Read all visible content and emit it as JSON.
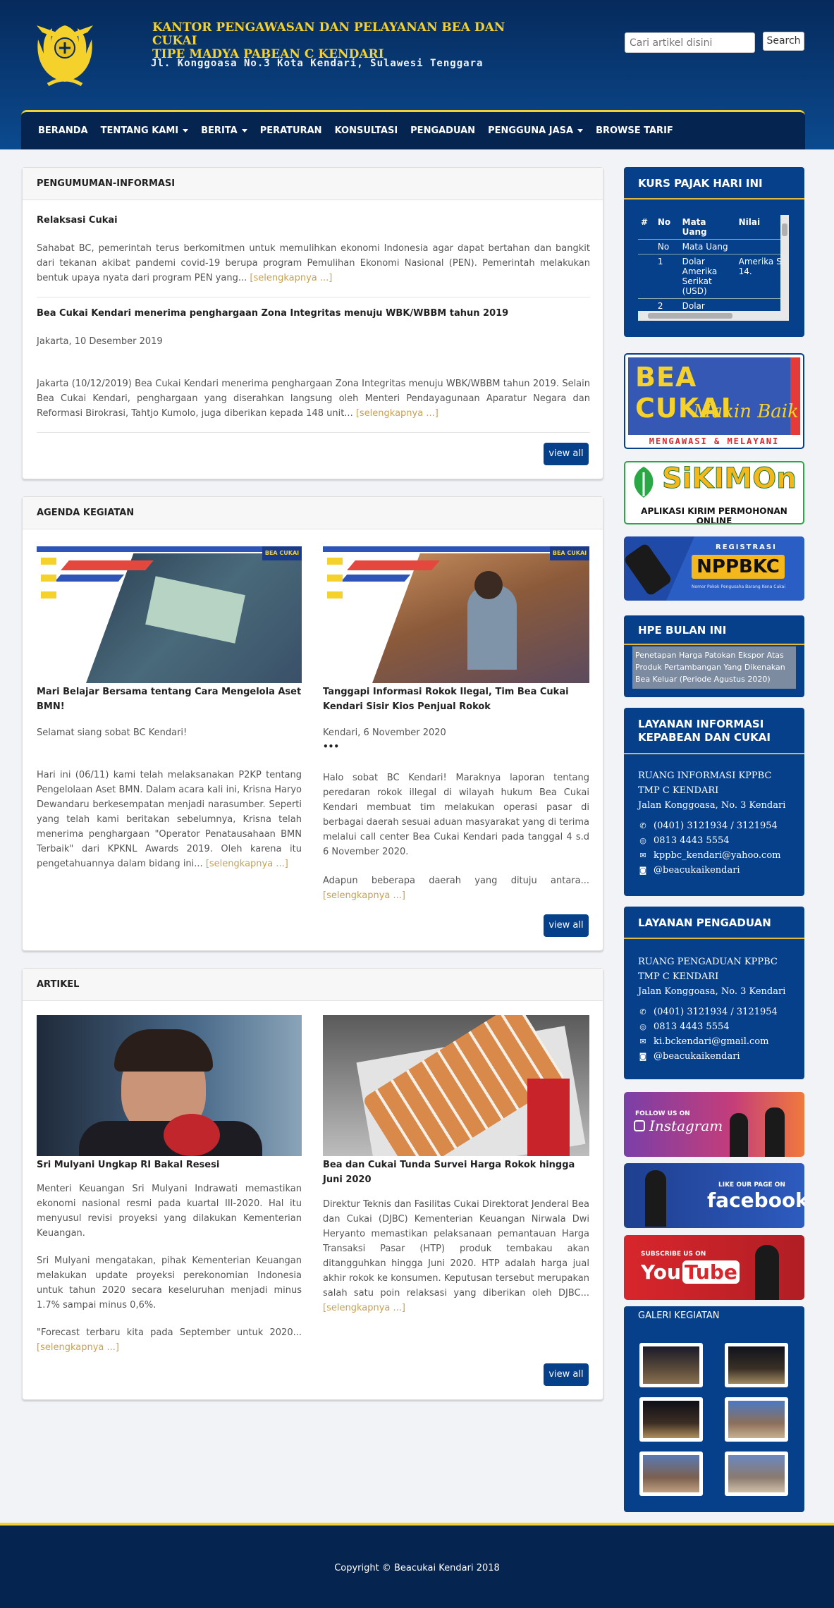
{
  "header": {
    "title_line1": "KANTOR PENGAWASAN DAN PELAYANAN BEA DAN CUKAI",
    "title_line2": "TIPE MADYA PABEAN C KENDARI",
    "address": "Jl. Konggoasa No.3 Kota Kendari, Sulawesi Tenggara",
    "search_placeholder": "Cari artikel disini",
    "search_button": "Search"
  },
  "nav": {
    "items": [
      "BERANDA",
      "TENTANG KAMI",
      "BERITA",
      "PERATURAN",
      "KONSULTASI",
      "PENGADUAN",
      "PENGGUNA JASA",
      "BROWSE TARIF"
    ]
  },
  "pengumuman": {
    "title": "PENGUMUMAN-INFORMASI",
    "items": [
      {
        "title": "Relaksasi Cukai",
        "date": "",
        "text": "Sahabat BC, pemerintah terus berkomitmen untuk memulihkan ekonomi Indonesia agar dapat bertahan dan bangkit dari tekanan akibat pandemi covid-19 berupa program Pemulihan Ekonomi Nasional (PEN). Pemerintah melakukan bentuk upaya nyata dari program PEN yang...",
        "more": "[selengkapnya ...]"
      },
      {
        "title": "Bea Cukai Kendari menerima penghargaan Zona Integritas menuju WBK/WBBM tahun 2019",
        "date": "Jakarta, 10 Desember 2019",
        "text": "Jakarta (10/12/2019) Bea Cukai Kendari menerima penghargaan Zona Integritas menuju WBK/WBBM tahun 2019. Selain Bea Cukai Kendari, penghargaan yang diserahkan langsung oleh Menteri Pendayagunaan Aparatur Negara dan Reformasi Birokrasi, Tahtjo Kumolo, juga diberikan kepada 148 unit...",
        "more": "[selengkapnya ...]"
      }
    ],
    "view_all": "view all"
  },
  "agenda": {
    "title": "AGENDA KEGIATAN",
    "badge": "BEA CUKAI",
    "items": [
      {
        "title": "Mari Belajar Bersama tentang Cara Mengelola Aset BMN!",
        "date": "Selamat siang sobat BC Kendari!",
        "extra": "",
        "text": "Hari ini (06/11) kami telah melaksanakan P2KP tentang Pengelolaan Aset BMN. Dalam acara kali ini, Krisna Haryo Dewandaru berkesempatan menjadi narasumber. Seperti yang telah kami beritakan sebelumnya, Krisna telah menerima penghargaan \"Operator Penatausahaan BMN Terbaik\" dari KPKNL Awards 2019. Oleh karena itu pengetahuannya dalam bidang ini...",
        "more": "[selengkapnya ...]"
      },
      {
        "title": "Tanggapi Informasi Rokok Ilegal, Tim Bea Cukai Kendari Sisir Kios Penjual Rokok",
        "date": "Kendari, 6 November 2020",
        "extra": "•••",
        "text": "Halo sobat BC Kendari! Maraknya laporan tentang peredaran rokok illegal di wilayah hukum Bea Cukai Kendari membuat tim melakukan operasi pasar di berbagai daerah sesuai aduan masyarakat yang di terima melalui call center Bea Cukai Kendari pada tanggal 4 s.d 6 November 2020.",
        "text2": "Adapun beberapa daerah yang dituju antara...",
        "more": "[selengkapnya ...]"
      }
    ],
    "view_all": "view all"
  },
  "artikel": {
    "title": "ARTIKEL",
    "items": [
      {
        "title": "Sri Mulyani Ungkap RI Bakal Resesi",
        "p1": "Menteri Keuangan Sri Mulyani Indrawati memastikan ekonomi nasional resmi          pada kuartal III-2020. Hal itu menyusul revisi proyeksi yang dilakukan Kementerian Keuangan.",
        "p2": "Sri Mulyani mengatakan, pihak Kementerian Keuangan melakukan update proyeksi perekonomian Indonesia untuk tahun 2020 secara keseluruhan menjadi minus 1.7% sampai minus 0,6%.",
        "p3": "\"Forecast terbaru kita pada September untuk 2020...",
        "more": "[selengkapnya ...]"
      },
      {
        "title": "Bea dan Cukai Tunda Survei Harga Rokok hingga Juni 2020",
        "p1": "Direktur Teknis dan Fasilitas Cukai Direktorat Jenderal Bea dan Cukai (DJBC) Kementerian Keuangan Nirwala Dwi Heryanto memastikan pelaksanaan pemantauan Harga Transaksi Pasar (HTP) produk tembakau akan ditangguhkan hingga Juni 2020. HTP adalah harga jual akhir rokok ke konsumen. Keputusan tersebut merupakan salah satu poin relaksasi yang diberikan oleh DJBC...",
        "more": "[selengkapnya ...]"
      }
    ],
    "view_all": "view all"
  },
  "kurs": {
    "title": "KURS PAJAK HARI INI",
    "headers": [
      "#",
      "No",
      "Mata Uang",
      "Nilai"
    ],
    "sub": [
      "",
      "No",
      "Mata Uang",
      ""
    ],
    "rows": [
      {
        "n": "1",
        "cur": "Dolar Amerika Serikat (USD)",
        "img": "Amerika S",
        "val": "14."
      },
      {
        "n": "2",
        "cur": "Dolar",
        "img": "",
        "val": ""
      }
    ]
  },
  "banners": {
    "bc_title": "BEA CUKAI",
    "bc_script": "Makin Baik",
    "bc_tag": "MENGAWASI & MELAYANI",
    "sikimon": "SiKIMOn",
    "sikimon_sub": "APLIKASI KIRIM PERMOHONAN ONLINE",
    "nppbkc_reg": "REGISTRASI",
    "nppbkc": "NPPBKC",
    "nppbkc_sub": "Nomor Pokok Pengusaha Barang Kena Cukai",
    "ig_small": "FOLLOW US ON",
    "ig_big": "Instagram",
    "fb_small": "LIKE OUR PAGE ON",
    "fb_big": "facebook",
    "yt_small": "SUBSCRIBE US ON",
    "yt_you": "You",
    "yt_tube": "Tube"
  },
  "hpe": {
    "title": "HPE BULAN INI",
    "text": "Penetapan Harga Patokan Ekspor Atas Produk Pertambangan Yang Dikenakan Bea Keluar (Periode Agustus 2020)"
  },
  "layanan_info": {
    "title": "LAYANAN INFORMASI KEPABEAN DAN CUKAI",
    "lines": [
      "RUANG INFORMASI KPPBC TMP C KENDARI",
      "Jalan Konggoasa, No. 3 Kendari"
    ],
    "phone": "(0401) 3121934 / 3121954",
    "wa": "0813 4443 5554",
    "email": "kppbc_kendari@yahoo.com",
    "ig": "@beacukaikendari"
  },
  "layanan_pengaduan": {
    "title": "LAYANAN PENGADUAN",
    "lines": [
      "RUANG PENGADUAN KPPBC TMP C KENDARI",
      "Jalan Konggoasa, No. 3 Kendari"
    ],
    "phone": "(0401) 3121934 / 3121954",
    "wa": "0813 4443 5554",
    "email": "ki.bckendari@gmail.com",
    "ig": "@beacukaikendari"
  },
  "galeri": {
    "title": "GALERI KEGIATAN"
  },
  "footer": {
    "text": "Copyright © Beacukai Kendari 2018"
  },
  "colors": {
    "navy": "#05244f",
    "blue": "#07408a",
    "gold": "#f5d12c",
    "link": "#c9a04c"
  }
}
